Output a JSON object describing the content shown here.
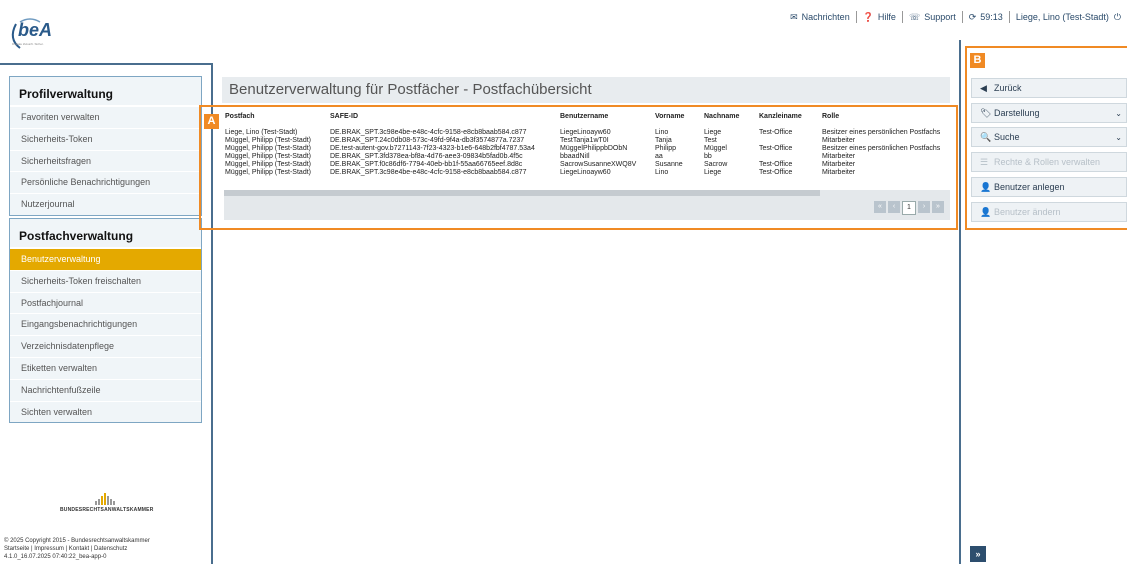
{
  "header": {
    "logo_text": "beA",
    "logo_sub": "Digitale Zukunft. Sicher.",
    "nav": [
      {
        "icon": "envelope-icon",
        "glyph": "✉",
        "label": "Nachrichten"
      },
      {
        "icon": "question-icon",
        "glyph": "❓",
        "label": "Hilfe"
      },
      {
        "icon": "support-icon",
        "glyph": "☏",
        "label": "Support"
      }
    ],
    "session_timer": "59:13",
    "user": "Liege, Lino (Test-Stadt)",
    "power_glyph": "⏻"
  },
  "sidebar": {
    "profil": {
      "title": "Profilverwaltung",
      "items": [
        "Favoriten verwalten",
        "Sicherheits-Token",
        "Sicherheitsfragen",
        "Persönliche Benachrichtigungen",
        "Nutzerjournal"
      ]
    },
    "postfach": {
      "title": "Postfachverwaltung",
      "items": [
        "Benutzerverwaltung",
        "Sicherheits-Token freischalten",
        "Postfachjournal",
        "Eingangsbenachrichtigungen",
        "Verzeichnisdatenpflege",
        "Etiketten verwalten",
        "Nachrichtenfußzeile",
        "Sichten verwalten"
      ],
      "active_index": 0
    },
    "footer": {
      "brand": "BUNDESRECHTSANWALTSKAMMER",
      "copyright": "© 2025 Copyright 2015 - Bundesrechtsanwaltskammer",
      "links": "Startseite | Impressum | Kontakt | Datenschutz",
      "version": "4.1.0_16.07.2025 07:40:22_bea-app-0"
    }
  },
  "main": {
    "title": "Benutzerverwaltung für Postfächer - Postfachübersicht",
    "annotation_label": "A",
    "columns": [
      "Postfach",
      "SAFE-ID",
      "Benutzername",
      "Vorname",
      "Nachname",
      "Kanzleiname",
      "Rolle"
    ],
    "rows": [
      [
        "Liege, Lino (Test-Stadt)",
        "DE.BRAK_SPT.3c98e4be-e48c-4cfc-9158-e8cb8baab584.c877",
        "LiegeLinoayw60",
        "Lino",
        "Liege",
        "Test-Office",
        "Besitzer eines persönlichen Postfachs"
      ],
      [
        "Müggel, Philipp (Test-Stadt)",
        "DE.BRAK_SPT.24c0db08-573c-49fd-9f4a-db3f3574877a.7237",
        "TestTanja1wT0I",
        "Tanja",
        "Test",
        "",
        "Mitarbeiter"
      ],
      [
        "Müggel, Philipp (Test-Stadt)",
        "DE.test-autent-gov.b7271143-7f23-4323-b1e6-648b2fbf4787.53a4",
        "MüggelPhilippbDObN",
        "Philipp",
        "Müggel",
        "Test-Office",
        "Besitzer eines persönlichen Postfachs"
      ],
      [
        "Müggel, Philipp (Test-Stadt)",
        "DE.BRAK_SPT.3fd378ea-bf8a-4d76-aee3-09834b5fad0b.4f5c",
        "bbaadNiIl",
        "aa",
        "bb",
        "",
        "Mitarbeiter"
      ],
      [
        "Müggel, Philipp (Test-Stadt)",
        "DE.BRAK_SPT.f0c86df6-7794-40eb-bb1f-55aa66765eef.8d8c",
        "SacrowSusanneXWQ8V",
        "Susanne",
        "Sacrow",
        "Test-Office",
        "Mitarbeiter"
      ],
      [
        "Müggel, Philipp (Test-Stadt)",
        "DE.BRAK_SPT.3c98e4be-e48c-4cfc-9158-e8cb8baab584.c877",
        "LiegeLinoayw60",
        "Lino",
        "Liege",
        "Test-Office",
        "Mitarbeiter"
      ]
    ],
    "pager": {
      "first": "«",
      "prev": "‹",
      "current": "1",
      "next": "›",
      "last": "»"
    }
  },
  "actions": {
    "annotation_label": "B",
    "buttons": [
      {
        "label": "Zurück",
        "icon": "back-icon",
        "glyph": "◀",
        "disabled": false,
        "chevron": false
      },
      {
        "label": "Darstellung",
        "icon": "tags-icon",
        "glyph": "🏷",
        "disabled": false,
        "chevron": true
      },
      {
        "label": "Suche",
        "icon": "search-icon",
        "glyph": "🔍",
        "disabled": false,
        "chevron": true
      },
      {
        "label": "Rechte & Rollen verwalten",
        "icon": "list-icon",
        "glyph": "☰",
        "disabled": true,
        "chevron": false
      },
      {
        "label": "Benutzer anlegen",
        "icon": "add-user-icon",
        "glyph": "👤",
        "disabled": false,
        "chevron": false
      },
      {
        "label": "Benutzer ändern",
        "icon": "user-icon",
        "glyph": "👤",
        "disabled": true,
        "chevron": false
      }
    ],
    "expand_glyph": "»"
  },
  "colors": {
    "accent": "#e4a900",
    "annotation": "#f08a24",
    "border": "#4a6e8e"
  }
}
